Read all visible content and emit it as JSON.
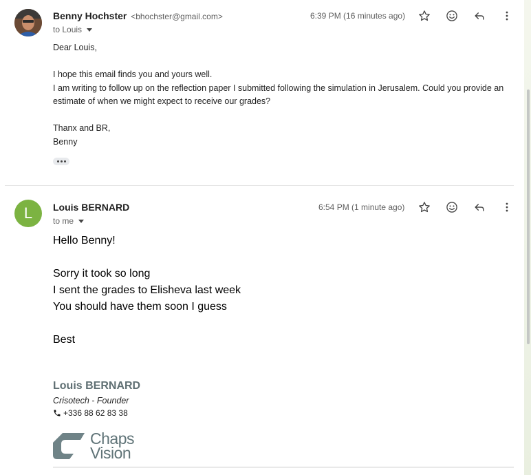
{
  "message1": {
    "sender_name": "Benny Hochster",
    "sender_email": "<bhochster@gmail.com>",
    "to_label": "to Louis",
    "time": "6:39 PM (16 minutes ago)",
    "greeting": "Dear Louis,",
    "para1": "I hope this email finds you and yours well.",
    "para2": "I am writing to follow up on the reflection paper I submitted following the simulation in Jerusalem. Could you provide an estimate of when we might expect to receive our grades?",
    "closing": "Thanx and BR,",
    "signoff": "Benny"
  },
  "message2": {
    "avatar_letter": "L",
    "sender_name": "Louis BERNARD",
    "to_label": "to me",
    "time": "6:54 PM (1 minute ago)",
    "line1": "Hello Benny!",
    "line2": "Sorry it took so long",
    "line3": "I sent the grades to Elisheva last week",
    "line4": "You should have them soon I guess",
    "line5": "Best",
    "signature": {
      "name": "Louis BERNARD",
      "title": "Crisotech - Founder",
      "phone": "+336 88 62 83 38",
      "logo_line1": "Chaps",
      "logo_line2": "Vision"
    }
  },
  "colors": {
    "avatar_green": "#7cb342",
    "signature_gray": "#5f6f73"
  }
}
